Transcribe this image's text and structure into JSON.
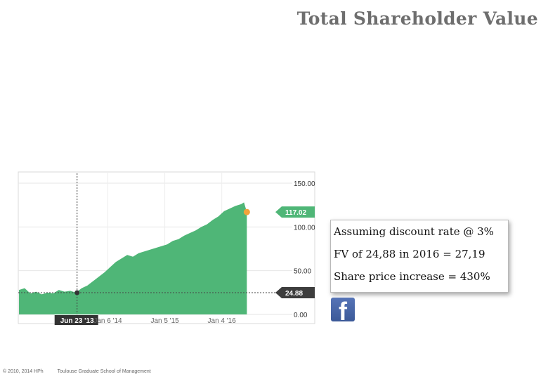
{
  "slide": {
    "title": "Total Shareholder Value",
    "notes": [
      "Assuming discount rate @ 3%",
      "FV of 24,88 in 2016 = 27,19",
      "Share price increase = 430%"
    ],
    "footer_copyright": "© 2010, 2014 HPh",
    "footer_school": "Toulouse Graduate School of Management",
    "social_icon": "facebook-icon",
    "social_letter": "f"
  },
  "chart_data": {
    "type": "area",
    "title": "",
    "xlabel": "",
    "ylabel": "",
    "ylim": [
      0,
      150
    ],
    "yticks": [
      "150.00",
      "100.00",
      "50.00",
      "0.00"
    ],
    "ytick_values": [
      150,
      100,
      50,
      0
    ],
    "xticks": [
      {
        "label": "Jun 23 '13",
        "x": 2013.47,
        "highlighted": true
      },
      {
        "label": "Jan 6 '14",
        "x": 2014.01,
        "highlighted": false
      },
      {
        "label": "Jan 5 '15",
        "x": 2015.01,
        "highlighted": false
      },
      {
        "label": "Jan 4 '16",
        "x": 2016.01,
        "highlighted": false
      }
    ],
    "xlim": [
      2012.45,
      2017.05
    ],
    "series": [
      {
        "points": [
          [
            2012.45,
            28
          ],
          [
            2012.55,
            30
          ],
          [
            2012.65,
            24
          ],
          [
            2012.75,
            26
          ],
          [
            2012.85,
            23
          ],
          [
            2012.95,
            25
          ],
          [
            2013.05,
            24
          ],
          [
            2013.15,
            28
          ],
          [
            2013.25,
            26
          ],
          [
            2013.35,
            27
          ],
          [
            2013.45,
            25
          ],
          [
            2013.55,
            30
          ],
          [
            2013.65,
            33
          ],
          [
            2013.75,
            38
          ],
          [
            2013.85,
            43
          ],
          [
            2013.95,
            48
          ],
          [
            2014.05,
            54
          ],
          [
            2014.15,
            60
          ],
          [
            2014.25,
            64
          ],
          [
            2014.35,
            68
          ],
          [
            2014.45,
            66
          ],
          [
            2014.55,
            70
          ],
          [
            2014.65,
            72
          ],
          [
            2014.75,
            74
          ],
          [
            2014.85,
            76
          ],
          [
            2014.95,
            78
          ],
          [
            2015.05,
            80
          ],
          [
            2015.15,
            84
          ],
          [
            2015.25,
            86
          ],
          [
            2015.35,
            90
          ],
          [
            2015.45,
            93
          ],
          [
            2015.55,
            96
          ],
          [
            2015.65,
            100
          ],
          [
            2015.75,
            103
          ],
          [
            2015.85,
            108
          ],
          [
            2015.95,
            112
          ],
          [
            2016.05,
            118
          ],
          [
            2016.15,
            121
          ],
          [
            2016.25,
            124
          ],
          [
            2016.35,
            126
          ],
          [
            2016.4,
            128
          ],
          [
            2016.45,
            117
          ]
        ]
      }
    ],
    "current_value": {
      "x": 2016.45,
      "y": 117.02,
      "label": "117.02"
    },
    "reference_value": {
      "x": 2013.47,
      "y": 24.88,
      "label": "24.88"
    },
    "colors": {
      "area": "#4fb677",
      "area_light": "#a9dcbc",
      "current_label_bg": "#4fb677",
      "reference_label_bg": "#3d3d3d",
      "current_dot": "#f2a33a"
    },
    "grid": true
  }
}
